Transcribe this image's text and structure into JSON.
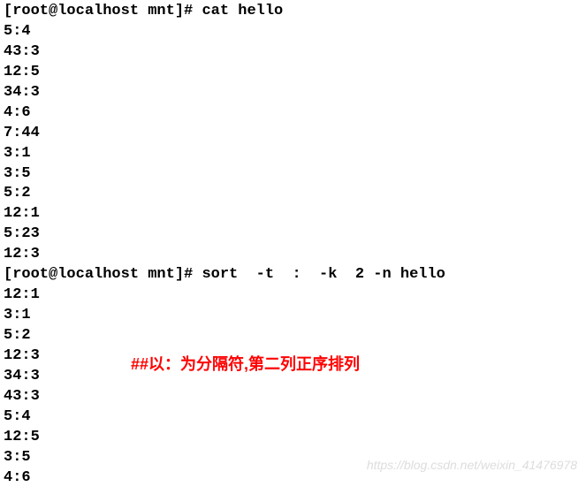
{
  "terminal": {
    "prompt": "[root@localhost mnt]# ",
    "cmd1": "cat hello",
    "output1": [
      "5:4",
      "43:3",
      "12:5",
      "34:3",
      "4:6",
      "7:44",
      "3:1",
      "3:5",
      "5:2",
      "12:1",
      "5:23",
      "12:3"
    ],
    "cmd2": "sort  -t  :  -k  2 -n hello",
    "output2": [
      "12:1",
      "3:1",
      "5:2",
      "12:3",
      "34:3",
      "43:3",
      "5:4",
      "12:5",
      "3:5",
      "4:6"
    ]
  },
  "annotation": "##以：为分隔符,第二列正序排列",
  "watermark": "https://blog.csdn.net/weixin_41476978"
}
